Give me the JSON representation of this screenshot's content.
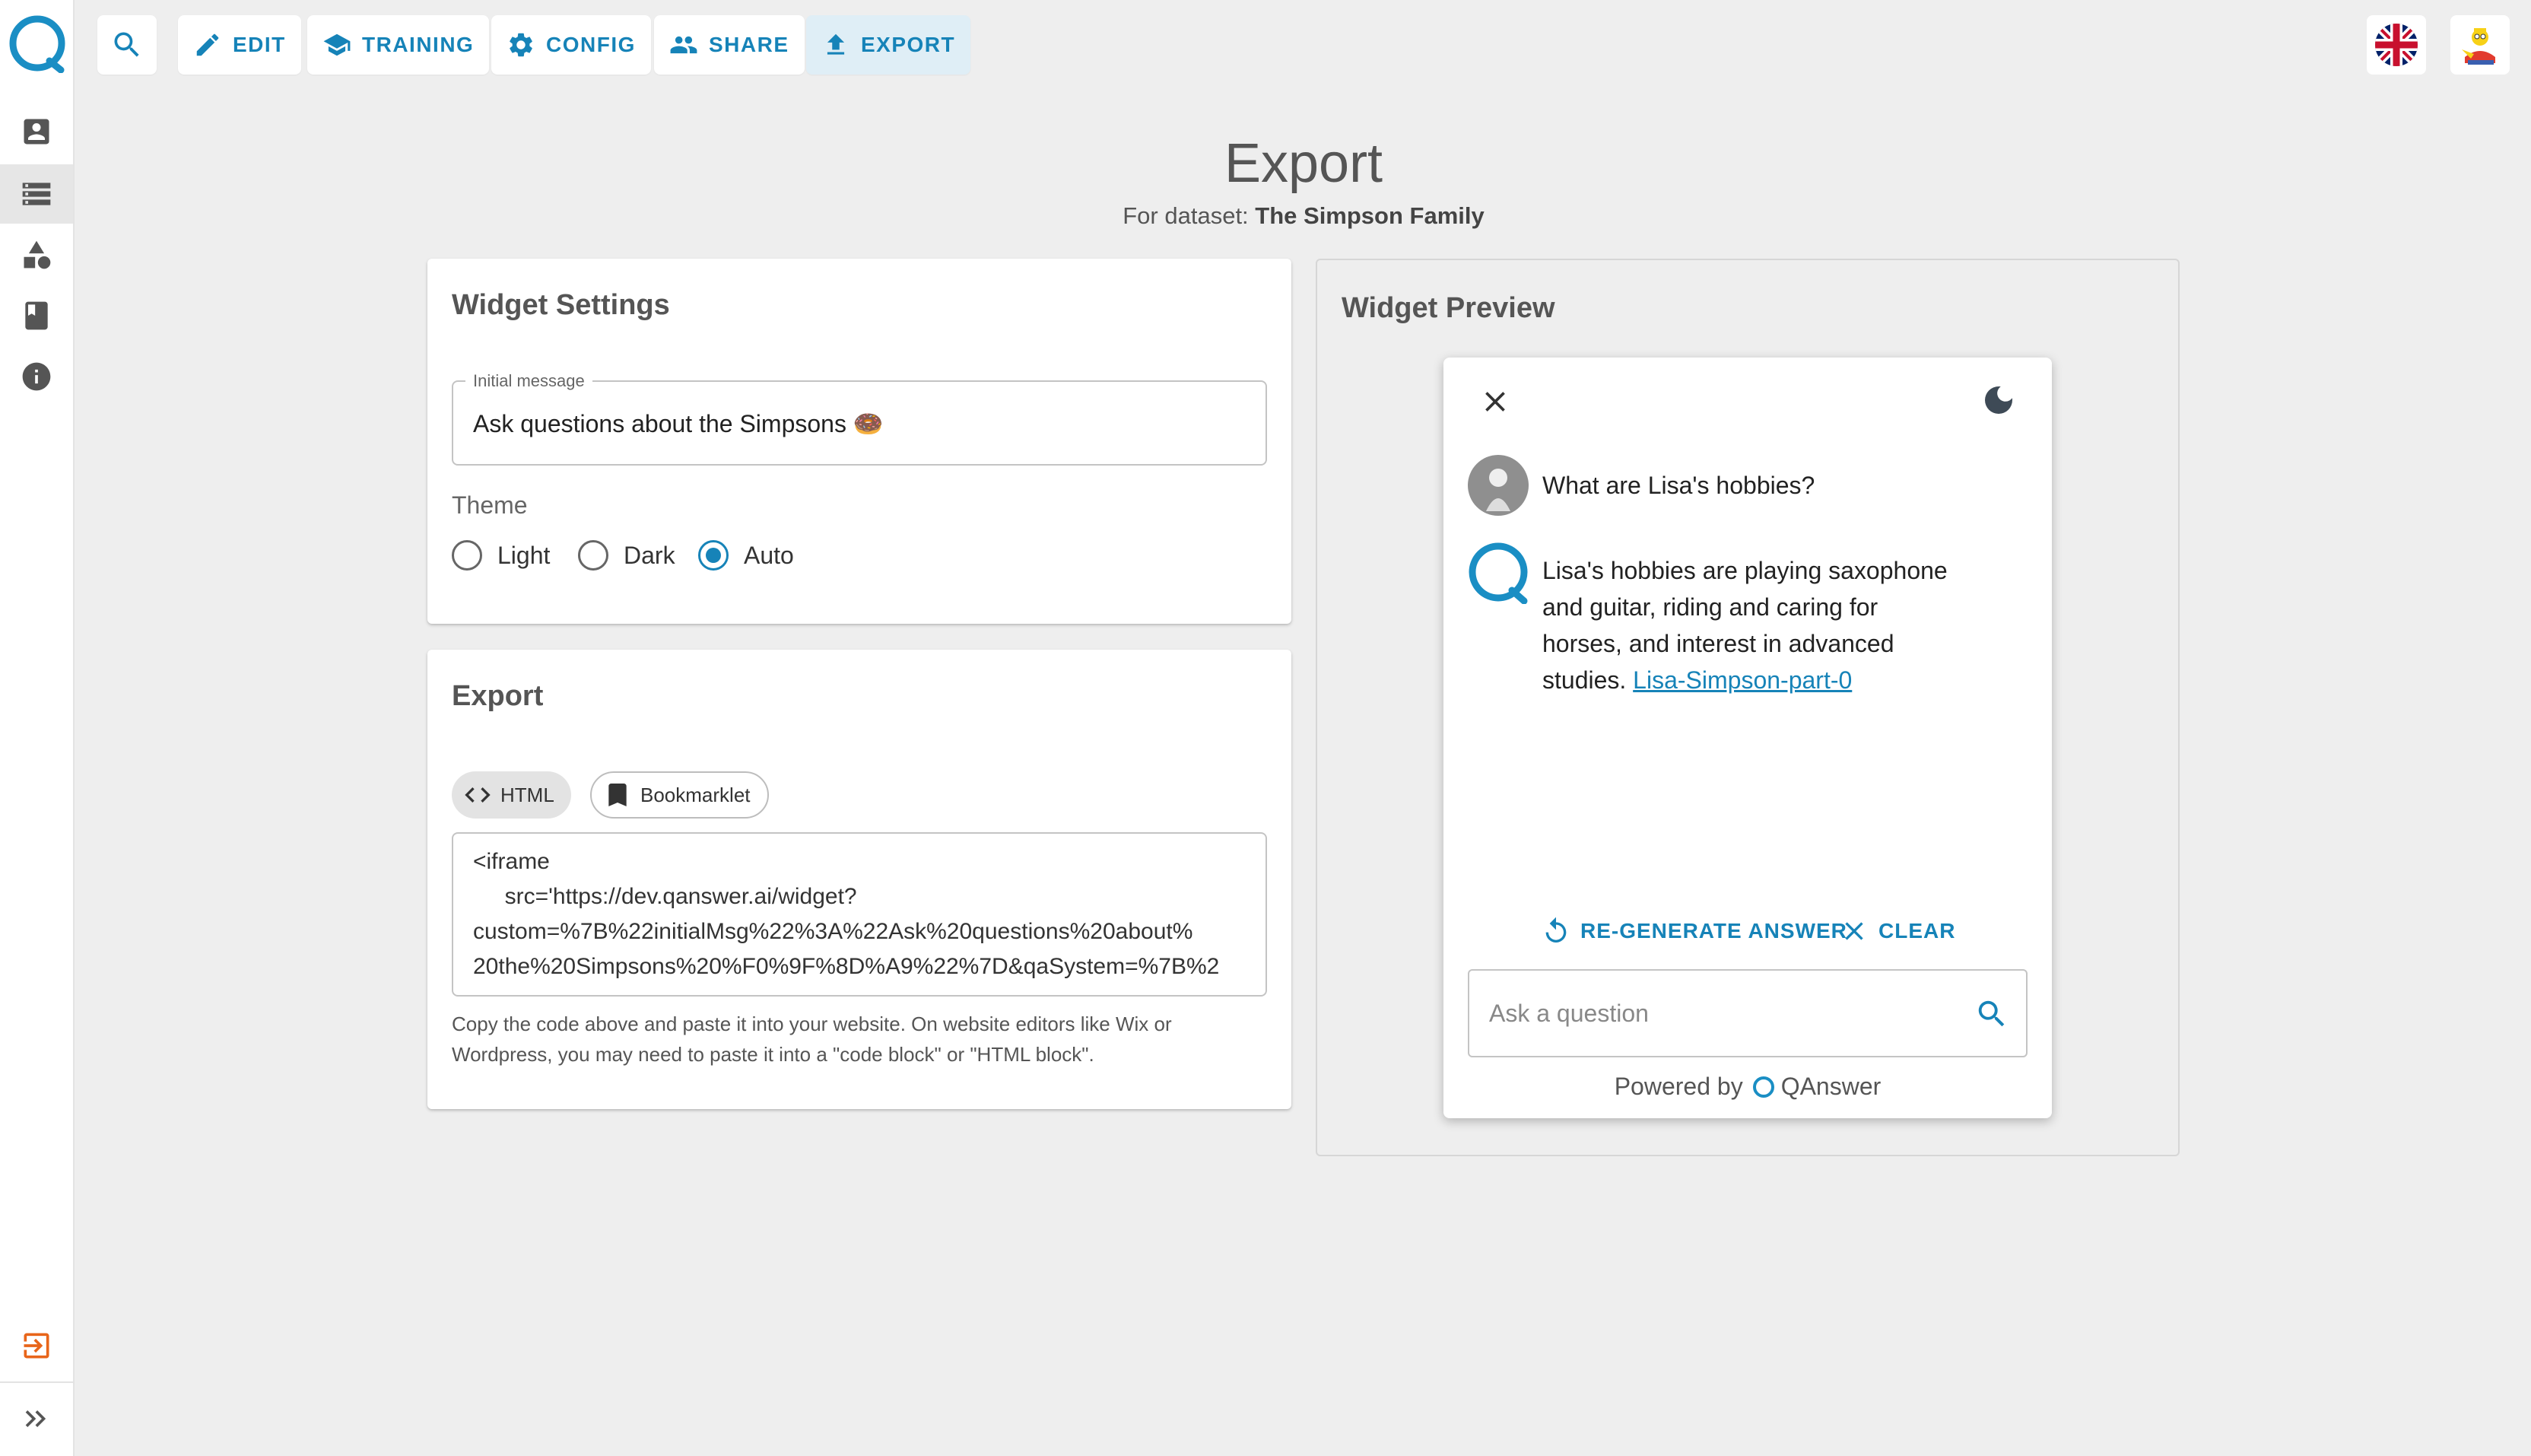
{
  "nav": {
    "edit": "EDIT",
    "training": "TRAINING",
    "config": "CONFIG",
    "share": "SHARE",
    "export": "EXPORT"
  },
  "page": {
    "title": "Export",
    "subtitle_prefix": "For dataset:",
    "dataset": "The Simpson Family"
  },
  "settings": {
    "title": "Widget Settings",
    "initial_message_label": "Initial message",
    "initial_message_value": "Ask questions about the Simpsons 🍩",
    "theme_label": "Theme",
    "theme_options": [
      "Light",
      "Dark",
      "Auto"
    ],
    "theme_selected": "Auto"
  },
  "export": {
    "title": "Export",
    "tabs": [
      "HTML",
      "Bookmarklet"
    ],
    "code_lines": [
      "<iframe",
      "     src='https://dev.qanswer.ai/widget?",
      "custom=%7B%22initialMsg%22%3A%22Ask%20questions%20about%",
      "20the%20Simpsons%20%F0%9F%8D%A9%22%7D&qaSystem=%7B%2"
    ],
    "helper_line1": "Copy the code above and paste it into your website. On website editors like Wix or",
    "helper_line2": "Wordpress, you may need to paste it into a \"code block\" or \"HTML block\"."
  },
  "preview": {
    "title": "Widget Preview",
    "question": "What are Lisa's hobbies?",
    "answer_lines": [
      "Lisa's hobbies are playing saxophone",
      "and guitar, riding and caring for",
      "horses, and interest in advanced"
    ],
    "answer_last_prefix": "studies.",
    "answer_source": "Lisa-Simpson-part-0",
    "regenerate": "RE-GENERATE ANSWER",
    "clear": "CLEAR",
    "input_placeholder": "Ask a question",
    "powered_by": "Powered by",
    "brand": "QAnswer"
  },
  "colors": {
    "accent": "#1683b8",
    "logout": "#e8651a"
  }
}
